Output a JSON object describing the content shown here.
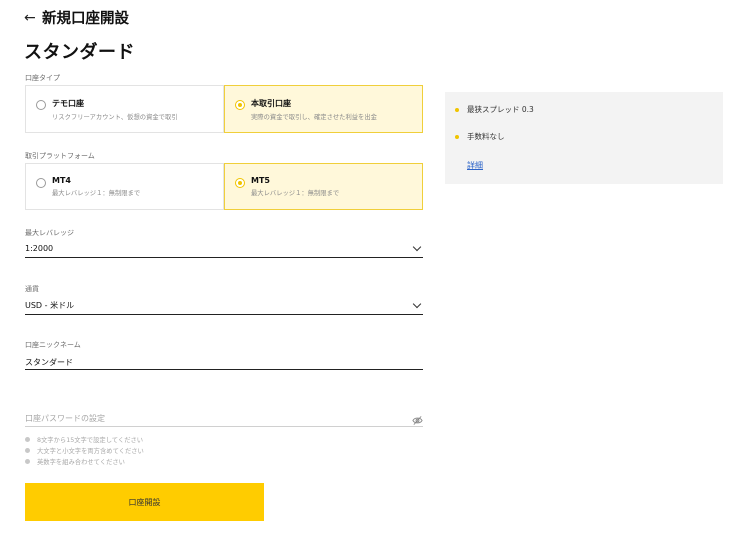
{
  "header": {
    "back_icon": "arrow-left-icon",
    "title": "新規口座開設"
  },
  "section_title": "スタンダード",
  "account_type": {
    "label": "口座タイプ",
    "options": [
      {
        "title": "テモ口座",
        "desc": "リスクフリーアカウント、仮想の資金で取引",
        "selected": false
      },
      {
        "title": "本取引口座",
        "desc": "実際の資金で取引し、確定させた利益を出金",
        "selected": true
      }
    ]
  },
  "platform": {
    "label": "取引プラットフォーム",
    "options": [
      {
        "title": "MT4",
        "desc": "最大レバレッジ１：無制限まで",
        "selected": false
      },
      {
        "title": "MT5",
        "desc": "最大レバレッジ１：無制限まで",
        "selected": true
      }
    ]
  },
  "leverage": {
    "label": "最大レバレッジ",
    "value": "1:2000"
  },
  "currency": {
    "label": "通貨",
    "value": "USD - 米ドル"
  },
  "nickname": {
    "label": "口座ニックネーム",
    "value": "スタンダード"
  },
  "password": {
    "placeholder": "口座パスワードの設定",
    "toggle_icon": "eye-off-icon",
    "hints": [
      "8文字から15文字で設定してください",
      "大文字と小文字を両方含めてください",
      "英数字を組み合わせてください"
    ]
  },
  "submit_label": "口座開設",
  "info_panel": {
    "items": [
      "最狭スプレッド 0.3",
      "手数料なし"
    ],
    "link_label": "詳細"
  },
  "colors": {
    "accent": "#ffcc00",
    "selected_bg": "#fff8da",
    "link": "#2d64c8",
    "panel_bg": "#f3f3f3"
  }
}
